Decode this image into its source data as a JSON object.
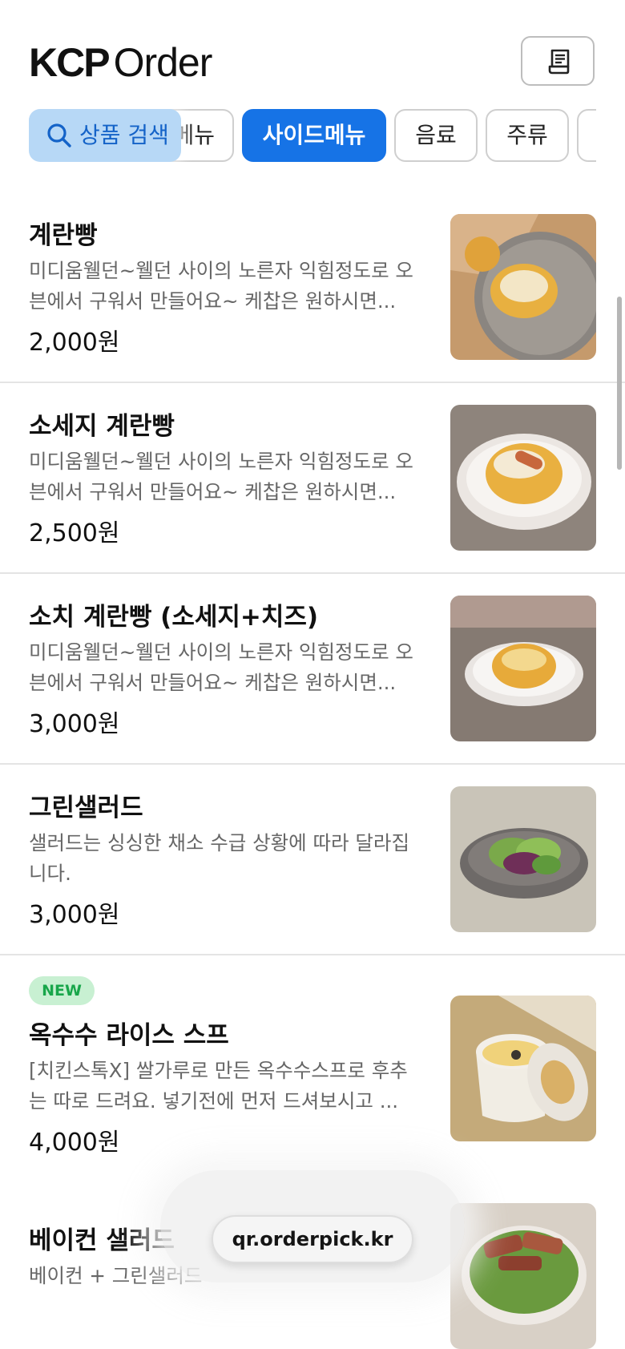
{
  "header": {
    "logo_kcp": "KCP",
    "logo_order": "Order",
    "receipt_icon": "receipt-icon"
  },
  "search": {
    "label": "상품 검색",
    "icon": "search-icon"
  },
  "tabs": [
    {
      "label": "메뉴",
      "active": false
    },
    {
      "label": "사이드메뉴",
      "active": true
    },
    {
      "label": "음료",
      "active": false
    },
    {
      "label": "주류",
      "active": false
    },
    {
      "label": "",
      "active": false
    }
  ],
  "items": [
    {
      "name": "계란빵",
      "desc": "미디움웰던~웰던 사이의 노른자 익힘정도로 오븐에서 구워서 만들어요~ 케찹은 원하시면...",
      "price": "2,000원",
      "badge": ""
    },
    {
      "name": "소세지 계란빵",
      "desc": "미디움웰던~웰던 사이의 노른자 익힘정도로 오븐에서 구워서 만들어요~ 케찹은 원하시면...",
      "price": "2,500원",
      "badge": ""
    },
    {
      "name": "소치 계란빵 (소세지+치즈)",
      "desc": "미디움웰던~웰던 사이의 노른자 익힘정도로 오븐에서 구워서 만들어요~ 케찹은 원하시면...",
      "price": "3,000원",
      "badge": ""
    },
    {
      "name": "그린샐러드",
      "desc": "샐러드는 싱싱한 채소 수급 상황에 따라 달라집니다.",
      "price": "3,000원",
      "badge": ""
    },
    {
      "name": "옥수수 라이스 스프",
      "desc": "[치킨스톡X] 쌀가루로 만든 옥수수스프로 후추는 따로 드려요. 넣기전에 먼저 드셔보시고 ...",
      "price": "4,000원",
      "badge": "NEW"
    },
    {
      "name": "베이컨 샐러드",
      "desc": "베이컨 + 그린샐러드",
      "price": "",
      "badge": ""
    }
  ],
  "footer": {
    "url": "qr.orderpick.kr"
  },
  "colors": {
    "accent": "#1673e6",
    "search_chip": "#b7d8f6",
    "new_badge_bg": "#c8f0d2",
    "new_badge_text": "#18a64a"
  }
}
